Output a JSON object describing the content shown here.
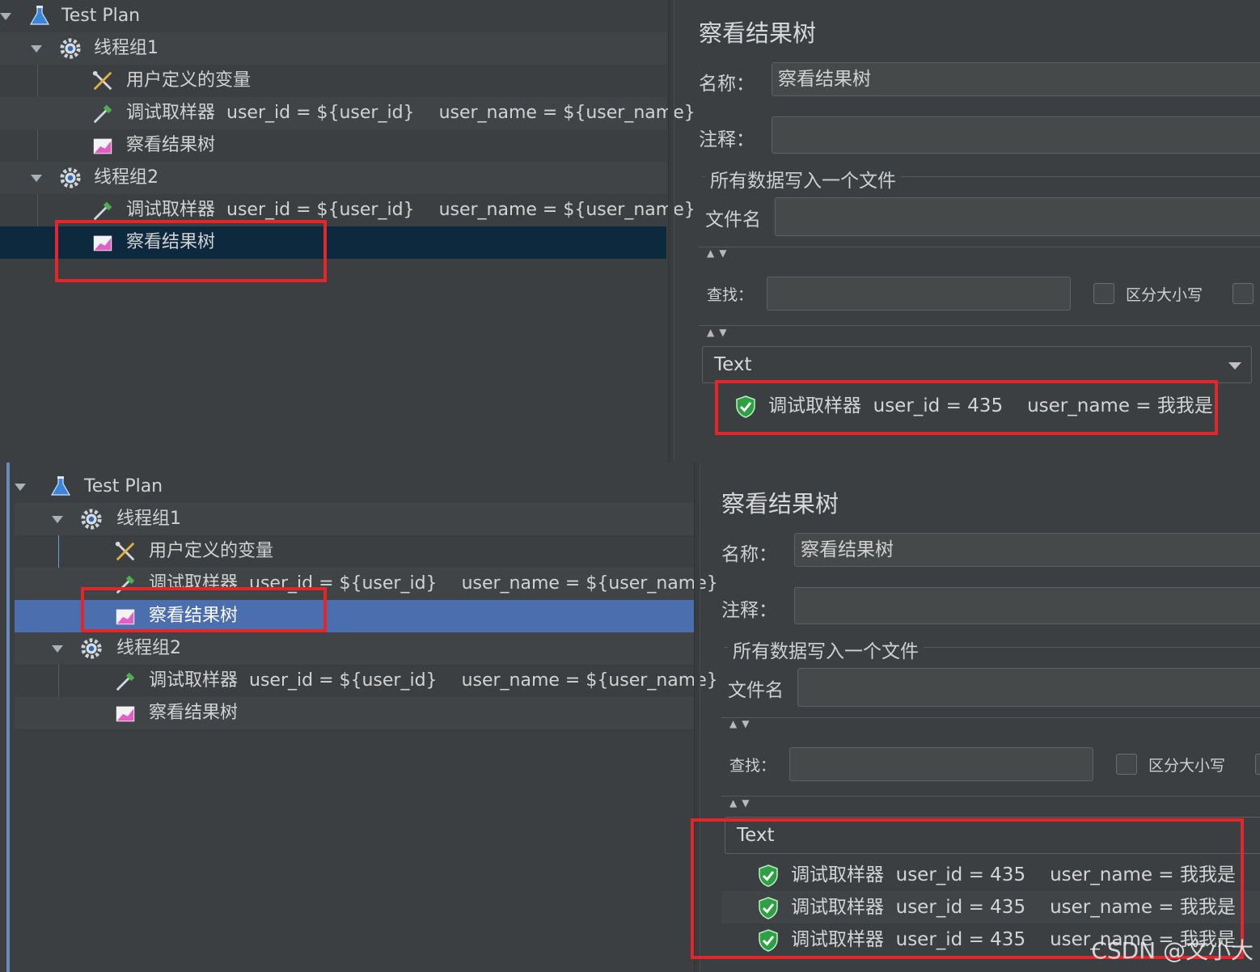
{
  "top": {
    "tree": [
      {
        "label": "Test Plan",
        "icon": "flask-icon"
      },
      {
        "label": "线程组1",
        "icon": "gear-icon"
      },
      {
        "label": "用户定义的变量",
        "icon": "tools-icon"
      },
      {
        "label": "调试取样器",
        "extra1": "user_id = ${user_id}",
        "extra2": "user_name = ${user_name}",
        "icon": "pipette-icon"
      },
      {
        "label": "察看结果树",
        "icon": "chart-icon"
      },
      {
        "label": "线程组2",
        "icon": "gear-icon"
      },
      {
        "label": "调试取样器",
        "extra1": "user_id = ${user_id}",
        "extra2": "user_name = ${user_name}",
        "icon": "pipette-icon"
      },
      {
        "label": "察看结果树",
        "icon": "chart-icon",
        "selected": true
      }
    ],
    "right": {
      "title": "察看结果树",
      "name_label": "名称：",
      "name_value": "察看结果树",
      "comment_label": "注释：",
      "comment_value": "",
      "file_group": "所有数据写入一个文件",
      "file_label": "文件名",
      "file_value": "",
      "search_label": "查找：",
      "search_value": "",
      "case_label": "区分大小写",
      "renderer": "Text",
      "results": [
        {
          "label": "调试取样器",
          "extra1": "user_id = 435",
          "extra2": "user_name = 我我是",
          "status": "success"
        }
      ]
    }
  },
  "bottom": {
    "tree": [
      {
        "label": "Test Plan",
        "icon": "flask-icon"
      },
      {
        "label": "线程组1",
        "icon": "gear-icon"
      },
      {
        "label": "用户定义的变量",
        "icon": "tools-icon"
      },
      {
        "label": "调试取样器",
        "extra1": "user_id = ${user_id}",
        "extra2": "user_name = ${user_name}",
        "icon": "pipette-icon"
      },
      {
        "label": "察看结果树",
        "icon": "chart-icon",
        "selected": true
      },
      {
        "label": "线程组2",
        "icon": "gear-icon"
      },
      {
        "label": "调试取样器",
        "extra1": "user_id = ${user_id}",
        "extra2": "user_name = ${user_name}",
        "icon": "pipette-icon"
      },
      {
        "label": "察看结果树",
        "icon": "chart-icon"
      }
    ],
    "right": {
      "title": "察看结果树",
      "name_label": "名称：",
      "name_value": "察看结果树",
      "comment_label": "注释：",
      "comment_value": "",
      "file_group": "所有数据写入一个文件",
      "file_label": "文件名",
      "file_value": "",
      "search_label": "查找：",
      "search_value": "",
      "case_label": "区分大小写",
      "renderer": "Text",
      "results": [
        {
          "label": "调试取样器",
          "extra1": "user_id = 435",
          "extra2": "user_name = 我我是",
          "status": "success"
        },
        {
          "label": "调试取样器",
          "extra1": "user_id = 435",
          "extra2": "user_name = 我我是",
          "status": "success"
        },
        {
          "label": "调试取样器",
          "extra1": "user_id = 435",
          "extra2": "user_name = 我我是",
          "status": "success"
        }
      ]
    }
  },
  "watermark": "CSDN @文小大",
  "colors": {
    "highlight": "#e3262a",
    "selection_dark": "#0d293e",
    "selection_blue": "#4b6eaf",
    "success": "#2ea043"
  }
}
